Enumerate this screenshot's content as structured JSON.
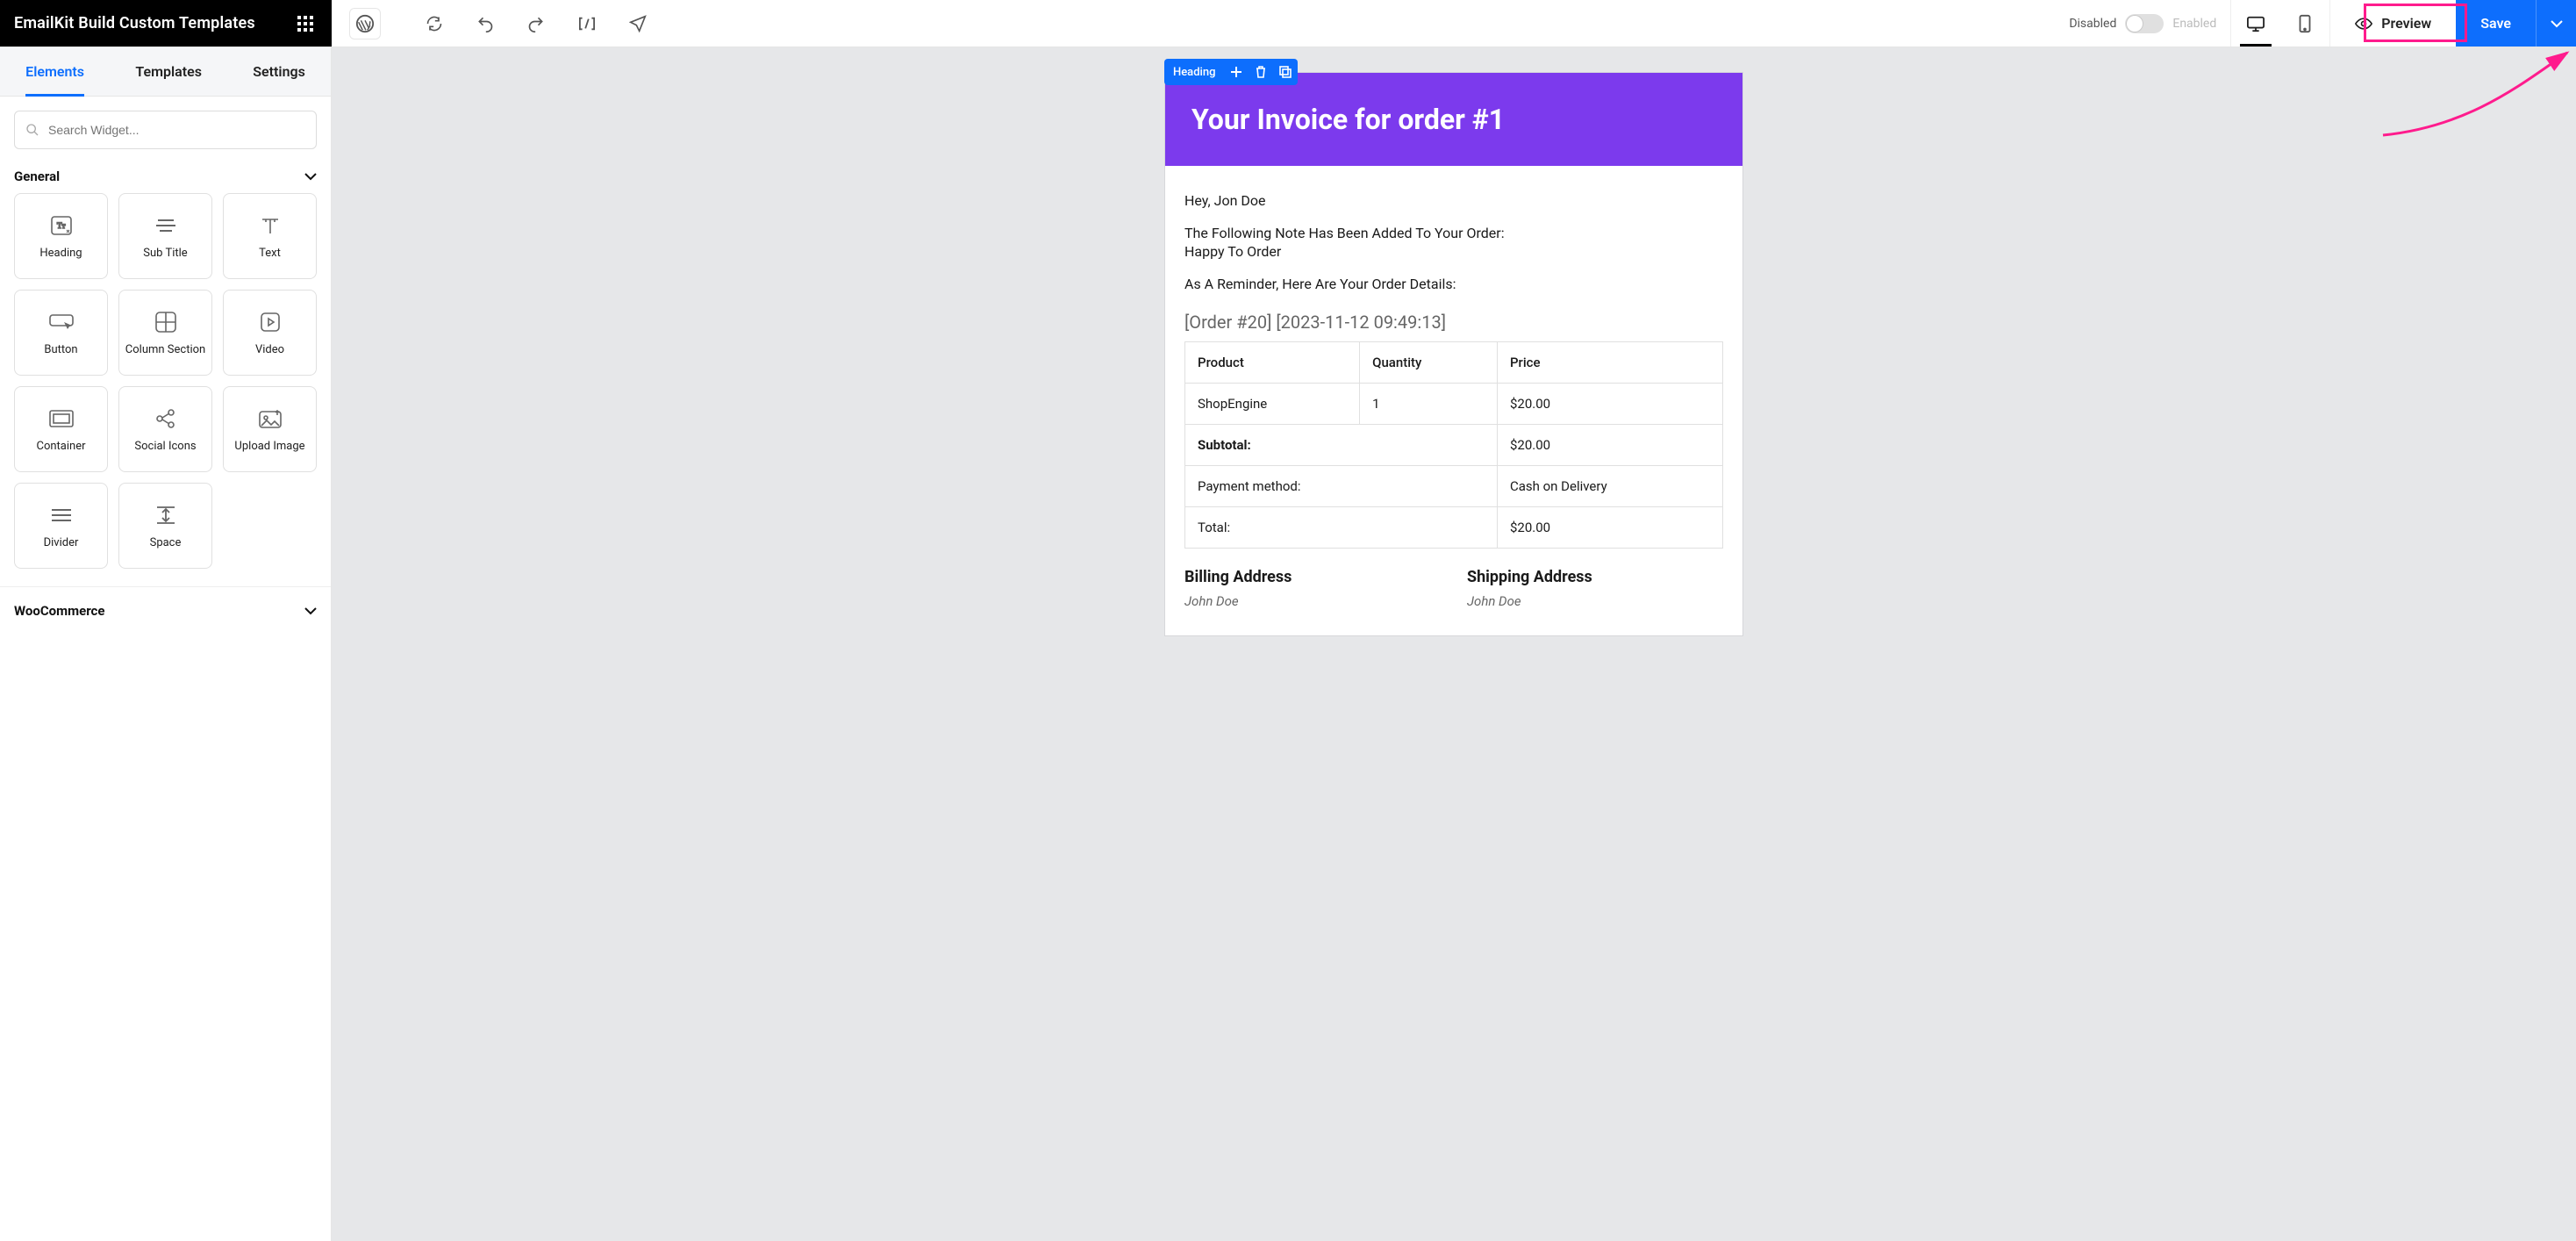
{
  "topbar": {
    "title": "EmailKit Build Custom Templates",
    "responsive": {
      "disabled_label": "Disabled",
      "enabled_label": "Enabled"
    },
    "preview_label": "Preview",
    "save_label": "Save"
  },
  "sidebar": {
    "tabs": [
      {
        "label": "Elements",
        "active": true
      },
      {
        "label": "Templates",
        "active": false
      },
      {
        "label": "Settings",
        "active": false
      }
    ],
    "search_placeholder": "Search Widget...",
    "sections": [
      {
        "title": "General",
        "widgets": [
          {
            "id": "heading",
            "label": "Heading"
          },
          {
            "id": "subtitle",
            "label": "Sub Title"
          },
          {
            "id": "text",
            "label": "Text"
          },
          {
            "id": "button",
            "label": "Button"
          },
          {
            "id": "column-section",
            "label": "Column Section"
          },
          {
            "id": "video",
            "label": "Video"
          },
          {
            "id": "container",
            "label": "Container"
          },
          {
            "id": "social-icons",
            "label": "Social Icons"
          },
          {
            "id": "upload-image",
            "label": "Upload Image"
          },
          {
            "id": "divider",
            "label": "Divider"
          },
          {
            "id": "space",
            "label": "Space"
          }
        ]
      },
      {
        "title": "WooCommerce",
        "widgets": []
      }
    ]
  },
  "canvas": {
    "selection_label": "Heading",
    "hero_title": "Your Invoice for order #1",
    "greeting": "Hey, Jon Doe",
    "note_intro": "The Following Note Has Been Added To Your Order:",
    "note_text": "Happy To Order",
    "reminder": "As A Reminder, Here Are Your Order Details:",
    "order_meta": "[Order #20] [2023-11-12 09:49:13]",
    "table": {
      "headers": [
        "Product",
        "Quantity",
        "Price"
      ],
      "rows": [
        {
          "product": "ShopEngine",
          "qty": "1",
          "price": "$20.00"
        }
      ],
      "summary": [
        {
          "label": "Subtotal:",
          "value": "$20.00",
          "bold": true
        },
        {
          "label": "Payment method:",
          "value": "Cash on Delivery",
          "bold": false
        },
        {
          "label": "Total:",
          "value": "$20.00",
          "bold": false
        }
      ]
    },
    "addresses": {
      "billing_title": "Billing Address",
      "shipping_title": "Shipping Address",
      "billing_name": "John Doe",
      "shipping_name": "John Doe"
    }
  }
}
